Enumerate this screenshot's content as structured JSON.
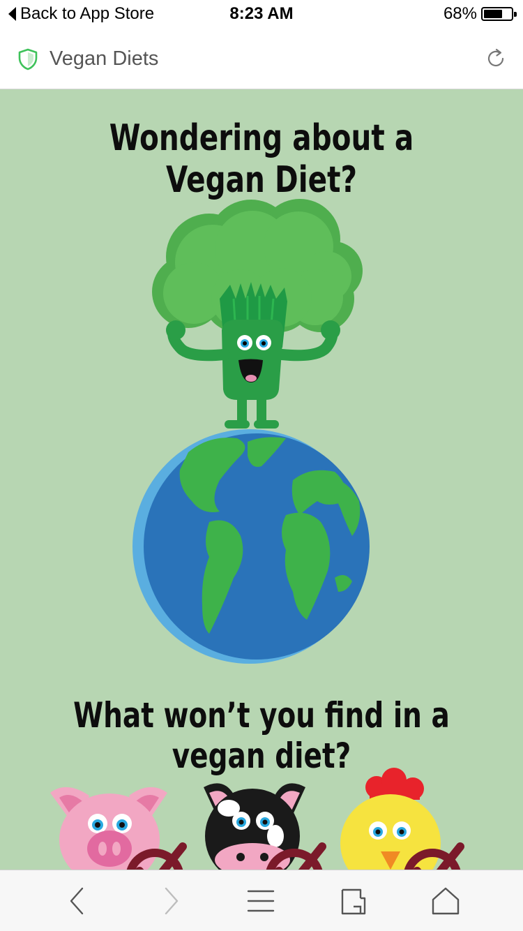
{
  "status_bar": {
    "back_label": "Back to App Store",
    "time": "8:23 AM",
    "battery_percent_label": "68%",
    "battery_level": 0.68
  },
  "header": {
    "title": "Vegan Diets",
    "shield_color": "#3ec25a"
  },
  "content": {
    "background": "#b7d6b2",
    "headline_1": "Wondering about a Vegan Diet?",
    "headline_2": "What won’t you find in a vegan diet?",
    "illustration": {
      "hero": "broccoli-character-standing-on-earth",
      "animals": [
        "pig",
        "cow",
        "chicken"
      ],
      "crossed_out_marks": 3
    }
  },
  "toolbar": {
    "items": [
      "back-icon",
      "forward-icon",
      "menu-icon",
      "tabs-icon",
      "home-icon"
    ]
  }
}
